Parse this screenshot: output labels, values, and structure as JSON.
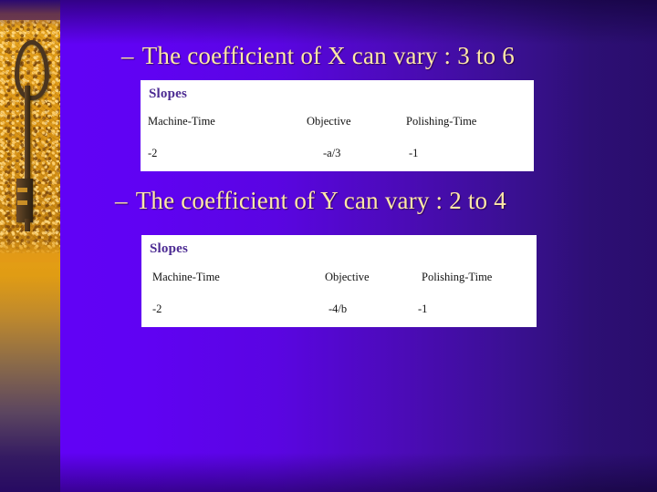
{
  "slide": {
    "decoration": {
      "key_icon_name": "antique-key-photo",
      "band_top_color": "#2d0a72",
      "band_sand_color": "#e2960f"
    },
    "background": {
      "left_color": "#6202f7",
      "right_color": "#290d6c"
    },
    "heading_color": "#ffe9a8",
    "title_color": "#4b2a92"
  },
  "bullets": [
    {
      "dash": "–",
      "text": "The coefficient of X can vary :  3 to 6",
      "variable": "X",
      "range_low": "3",
      "range_high": "6"
    },
    {
      "dash": "–",
      "text": "The coefficient of Y can vary : 2 to 4",
      "variable": "Y",
      "range_low": "2",
      "range_high": "4"
    }
  ],
  "tables": [
    {
      "title": "Slopes",
      "columns": [
        "Machine-Time",
        "Objective",
        "Polishing-Time"
      ],
      "rows": [
        [
          "-2",
          "-a/3",
          "-1"
        ]
      ]
    },
    {
      "title": "Slopes",
      "columns": [
        "Machine-Time",
        "Objective",
        "Polishing-Time"
      ],
      "rows": [
        [
          "-2",
          "-4/b",
          "-1"
        ]
      ]
    }
  ]
}
